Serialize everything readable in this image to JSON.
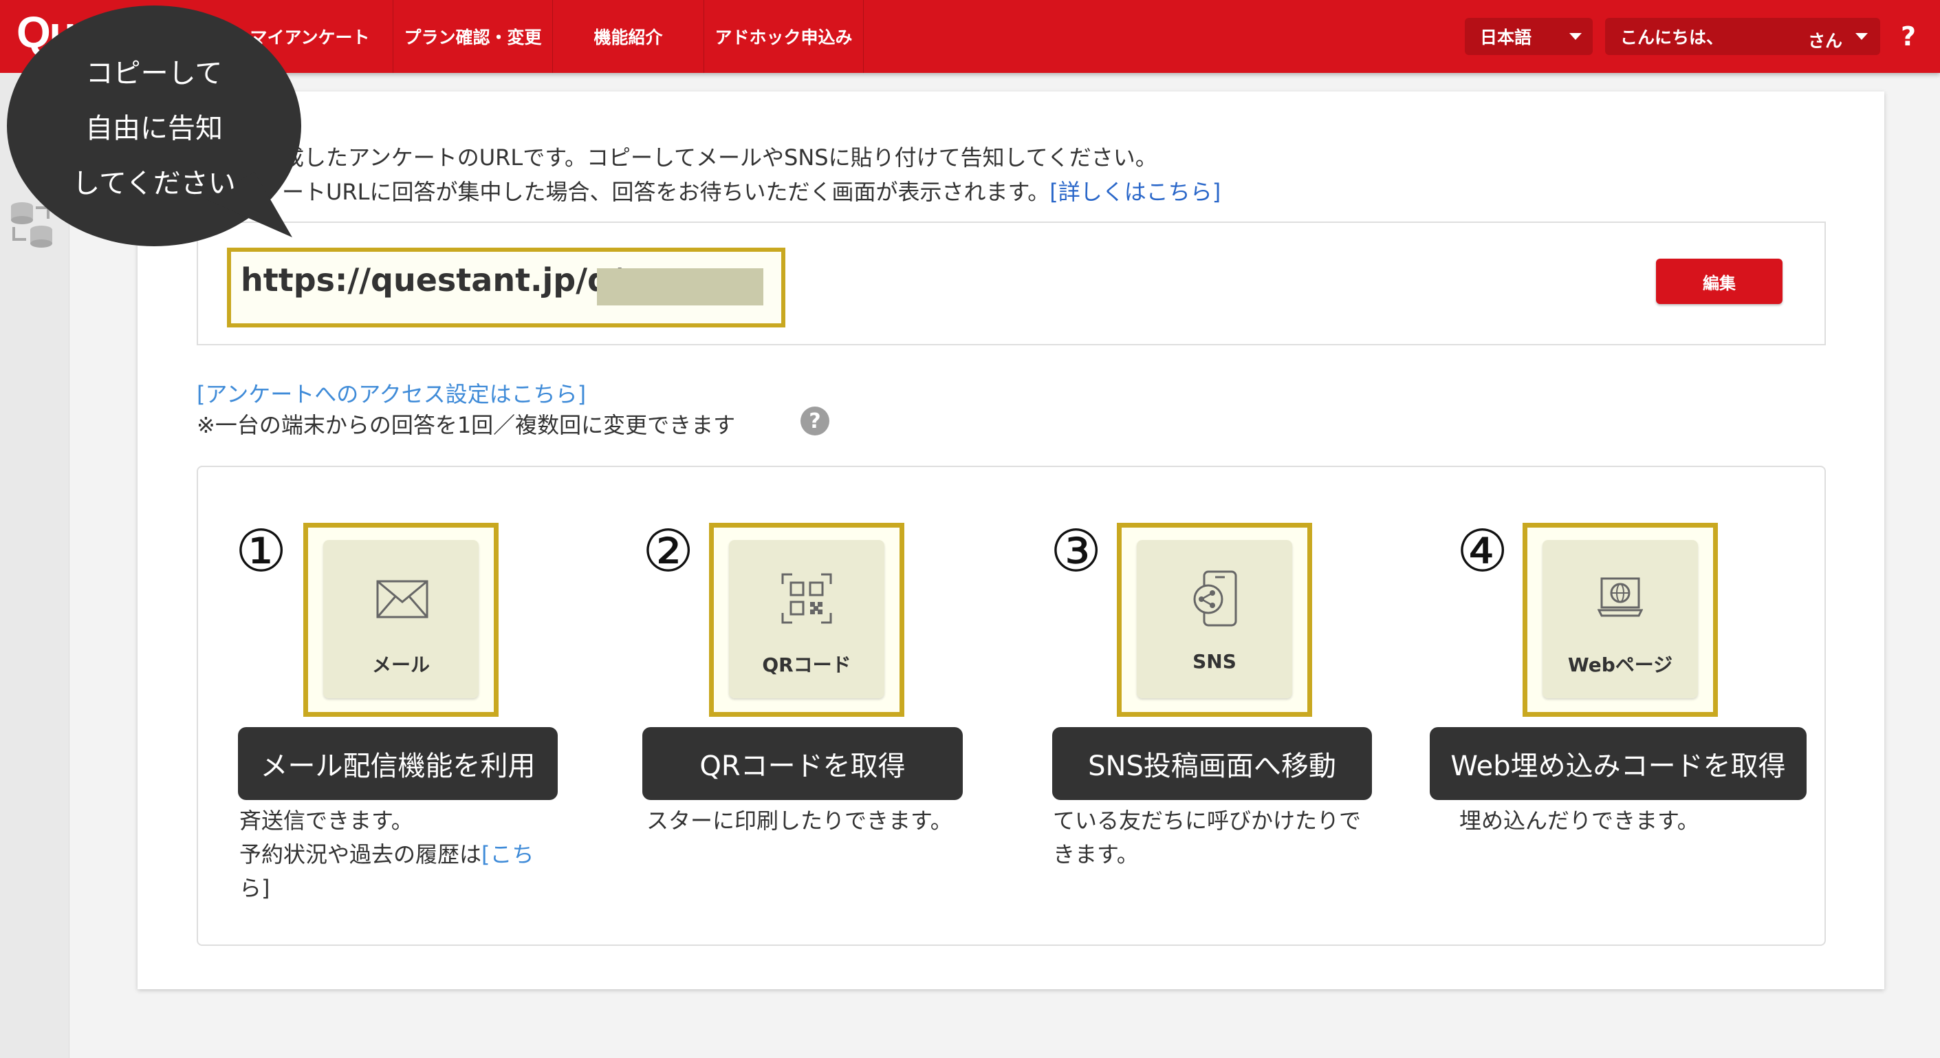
{
  "header": {
    "logo": "Qu",
    "nav": [
      "マイアンケート",
      "プラン確認・変更",
      "機能紹介",
      "アドホック申込み"
    ],
    "language": "日本語",
    "greeting": "こんにちは、",
    "greeting_suffix": "さん",
    "help": "?"
  },
  "intro": {
    "line1": "成したアンケートのURLです。コピーしてメールやSNSに貼り付けて告知してください。",
    "line2": "ートURLに回答が集中した場合、回答をお待ちいただく画面が表示されます。",
    "details_link": "[詳しくはこちら]"
  },
  "survey_url": {
    "url": "https://questant.jp/q/",
    "edit_button": "編集"
  },
  "access": {
    "link": "[アンケートへのアクセス設定はこちら]",
    "note": "※一台の端末からの回答を1回／複数回に変更できます",
    "help_icon": "?"
  },
  "methods": [
    {
      "number": "①",
      "tile_label": "メール",
      "icon": "mail-icon",
      "action": "メール配信機能を利用",
      "desc_lines": [
        "斉送信できます。",
        "予約状況や過去の履歴は"
      ],
      "desc_link1": "[こち",
      "desc_link2": "ら]"
    },
    {
      "number": "②",
      "tile_label": "QRコード",
      "icon": "qr-code-icon",
      "action": "QRコードを取得",
      "desc_lines": [
        "スターに印刷したりできます。"
      ]
    },
    {
      "number": "③",
      "tile_label": "SNS",
      "icon": "sns-share-icon",
      "action": "SNS投稿画面へ移動",
      "desc_lines": [
        "ている友だちに呼びかけたりで",
        "きます。"
      ]
    },
    {
      "number": "④",
      "tile_label": "Webページ",
      "icon": "web-page-icon",
      "action": "Web埋め込みコードを取得",
      "desc_lines": [
        "埋め込んだりできます。"
      ]
    }
  ],
  "callout": {
    "lines": [
      "コピーして",
      "自由に告知",
      "してください"
    ]
  },
  "colors": {
    "brand_red": "#d7131c",
    "highlight_gold": "#c9a820",
    "link_blue": "#2a67c9",
    "label_dark": "#333333"
  }
}
